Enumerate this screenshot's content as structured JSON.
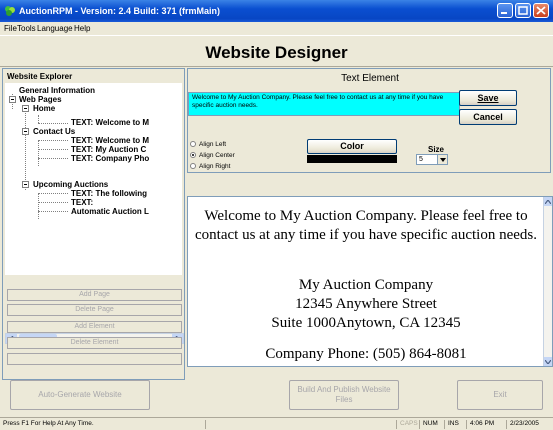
{
  "window": {
    "title": "AuctionRPM - Version: 2.4 Build: 371   (frmMain)"
  },
  "menu": [
    "File",
    "Tools",
    "Language",
    "Help"
  ],
  "header": {
    "title": "Website Designer"
  },
  "explorer": {
    "title": "Website Explorer",
    "tree": {
      "general": "General Information",
      "web_pages": "Web Pages",
      "home": "Home",
      "home_text": "TEXT: Welcome to M",
      "contact": "Contact Us",
      "contact_text1": "TEXT: Welcome to M",
      "contact_text2": "TEXT: My Auction C",
      "contact_text3": "TEXT: Company Pho",
      "upcoming": "Upcoming Auctions",
      "upcoming_text1": "TEXT: The following",
      "upcoming_text2": "TEXT:",
      "upcoming_auto": "Automatic Auction L"
    },
    "buttons": {
      "add_page": "Add Page",
      "delete_page": "Delete Page",
      "add_element": "Add Element",
      "delete_element": "Delete Element"
    }
  },
  "element": {
    "title": "Text Element",
    "text_value": "Welcome to My Auction Company. Please feel free to contact us at any time if you have specific auction needs.",
    "save": "Save",
    "cancel": "Cancel",
    "align_left": "Align Left",
    "align_center": "Align Center",
    "align_right": "Align Right",
    "selected_alignment": "Align Center",
    "color_button": "Color",
    "color_value": "#000000",
    "size_label": "Size",
    "size_value": "5"
  },
  "preview": {
    "paragraph1": "Welcome to My Auction Company. Please feel free to contact us at any time if you have specific auction needs.",
    "address": [
      "My Auction Company",
      "12345 Anywhere Street",
      "Suite 1000Anytown, CA 12345"
    ],
    "phone": "Company Phone: (505) 864-8081"
  },
  "bottom": {
    "auto_generate": "Auto-Generate Website",
    "build_publish": "Build And Publish Website Files",
    "exit": "Exit"
  },
  "status": {
    "help": "Press F1 For Help At Any Time.",
    "caps": "CAPS",
    "num": "NUM",
    "ins": "INS",
    "time": "4:06 PM",
    "date": "2/23/2005"
  },
  "colors": {
    "titlebar": "#0a4fd0",
    "text_input_bg": "#00ffff",
    "window_bg": "#ece9d8"
  }
}
